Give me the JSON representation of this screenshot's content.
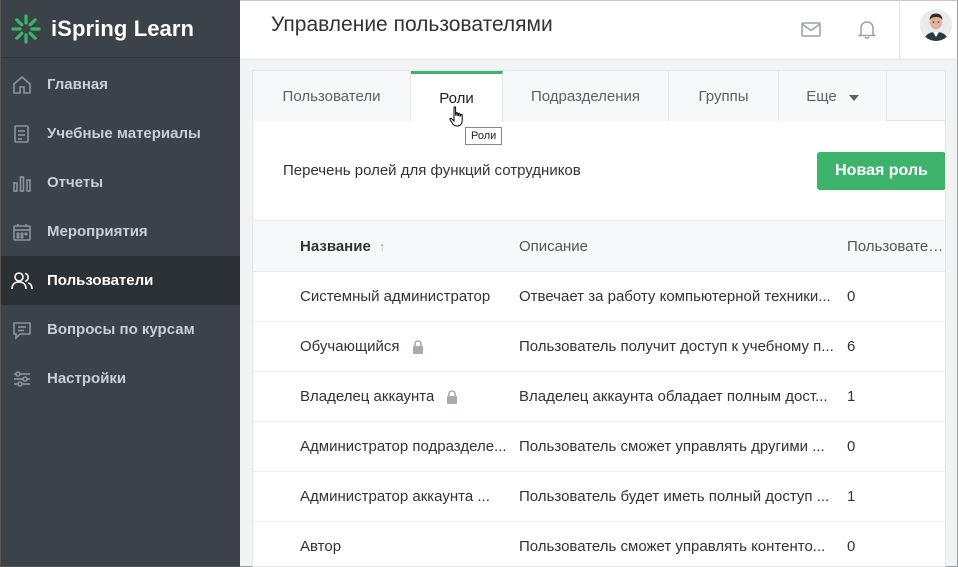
{
  "app": {
    "name": "iSpring Learn"
  },
  "sidebar": {
    "items": [
      {
        "label": "Главная",
        "icon": "home-icon",
        "active": false
      },
      {
        "label": "Учебные материалы",
        "icon": "materials-icon",
        "active": false
      },
      {
        "label": "Отчеты",
        "icon": "reports-icon",
        "active": false
      },
      {
        "label": "Мероприятия",
        "icon": "calendar-icon",
        "active": false
      },
      {
        "label": "Пользователи",
        "icon": "users-icon",
        "active": true
      },
      {
        "label": "Вопросы по курсам",
        "icon": "chat-icon",
        "active": false
      },
      {
        "label": "Настройки",
        "icon": "settings-icon",
        "active": false
      }
    ]
  },
  "header": {
    "title": "Управление пользователями",
    "icons": [
      "mail-icon",
      "bell-icon",
      "avatar"
    ]
  },
  "tabs": [
    {
      "label": "Пользователи",
      "active": false
    },
    {
      "label": "Роли",
      "active": true
    },
    {
      "label": "Подразделения",
      "active": false
    },
    {
      "label": "Группы",
      "active": false
    },
    {
      "label": "Еще",
      "active": false,
      "dropdown": true
    }
  ],
  "tooltip": "Роли",
  "toolbar": {
    "description": "Перечень ролей для функций сотрудников",
    "new_role_label": "Новая роль"
  },
  "table": {
    "columns": [
      "Название",
      "Описание",
      "Пользовате…"
    ],
    "sort_icon": "sort-up-arrow-icon",
    "rows": [
      {
        "name": "Системный администратор",
        "description": "Отвечает за работу компьютерной техники...",
        "users": "0",
        "locked": false
      },
      {
        "name": "Обучающийся",
        "description": "Пользователь получит доступ к учебному п...",
        "users": "6",
        "locked": true
      },
      {
        "name": "Владелец аккаунта",
        "description": "Владелец аккаунта обладает полным дост...",
        "users": "1",
        "locked": true
      },
      {
        "name": "Администратор подразделе...",
        "description": "Пользователь сможет управлять другими ...",
        "users": "0",
        "locked": false
      },
      {
        "name": "Администратор аккаунта ...",
        "description": "Пользователь будет иметь полный доступ ...",
        "users": "1",
        "locked": false
      },
      {
        "name": "Автор",
        "description": "Пользователь сможет управлять контенто...",
        "users": "0",
        "locked": false
      }
    ]
  },
  "colors": {
    "sidebar_bg": "#3b4248",
    "sidebar_active_bg": "#2c3135",
    "accent_green": "#3db36b"
  }
}
